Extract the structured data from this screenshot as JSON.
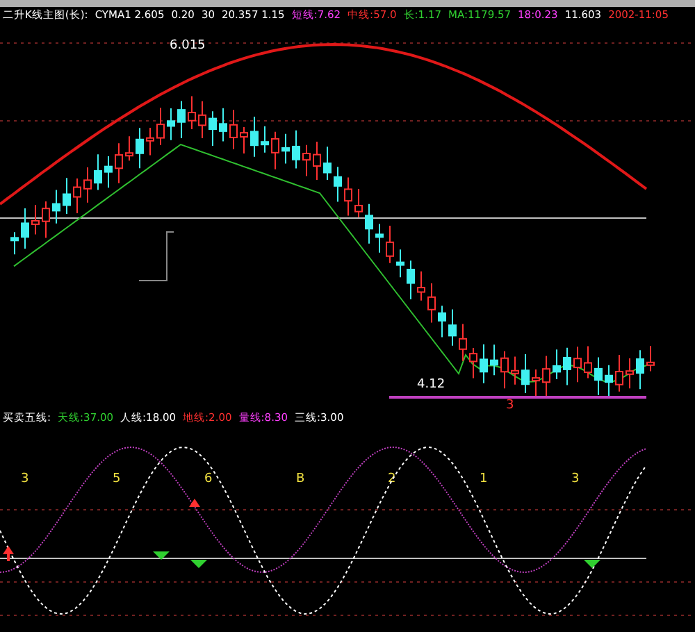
{
  "header": [
    {
      "text": "二升K线主图(长):",
      "color": "#ffffff"
    },
    {
      "text": "CYMA1 2.605",
      "color": "#ffffff"
    },
    {
      "text": "0.20",
      "color": "#ffffff"
    },
    {
      "text": "30",
      "color": "#ffffff"
    },
    {
      "text": "20.357 1.15",
      "color": "#ffffff"
    },
    {
      "text": "短线:7.62",
      "color": "#ff40ff"
    },
    {
      "text": "中线:57.0",
      "color": "#ff3030"
    },
    {
      "text": "长:1.17",
      "color": "#30d030"
    },
    {
      "text": "MA:1179.57",
      "color": "#30d030"
    },
    {
      "text": "18:0.23",
      "color": "#ff40ff"
    },
    {
      "text": "11.603",
      "color": "#ffffff"
    },
    {
      "text": "2002-11:05",
      "color": "#ff3030"
    }
  ],
  "price_labels": [
    {
      "kind": "high",
      "text": "6.015"
    },
    {
      "kind": "low",
      "text": "4.12"
    }
  ],
  "period_mark": "3",
  "legend": [
    {
      "text": "买卖五线:",
      "color": "#ffffff"
    },
    {
      "text": "天线:37.00",
      "color": "#30d030"
    },
    {
      "text": "人线:18.00",
      "color": "#ffffff"
    },
    {
      "text": "地线:2.00",
      "color": "#ff3030"
    },
    {
      "text": "量线:8.30",
      "color": "#ff40ff"
    },
    {
      "text": "三线:3.00",
      "color": "#ffffff"
    }
  ],
  "signal_digits": [
    "3",
    "5",
    "6",
    "B",
    "2",
    "1",
    "3"
  ]
}
